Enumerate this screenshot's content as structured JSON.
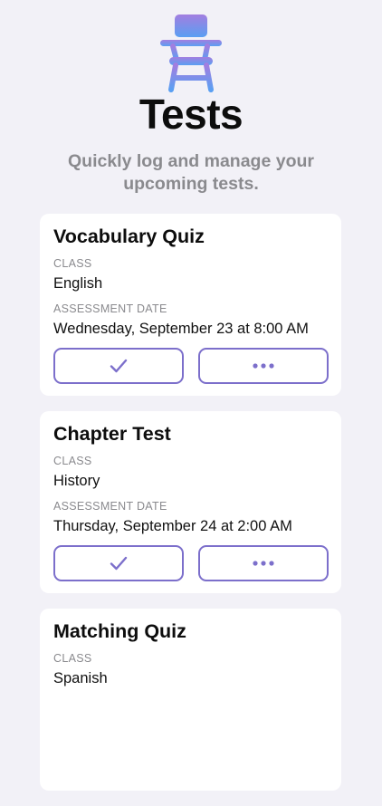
{
  "header": {
    "icon": "school-desk-icon",
    "title": "Tests",
    "subtitle": "Quickly log and manage your upcoming tests."
  },
  "colors": {
    "background": "#f2f1f7",
    "card": "#ffffff",
    "accent": "#7c6fcb",
    "icon_gradient_top": "#a27ee0",
    "icon_gradient_bottom": "#5a9ff2",
    "secondary_text": "#8a8a8e"
  },
  "tests": [
    {
      "title": "Vocabulary Quiz",
      "class_label": "CLASS",
      "class_value": "English",
      "date_label": "ASSESSMENT DATE",
      "date_value": "Wednesday, September 23 at 8:00 AM",
      "complete_icon": "checkmark-icon",
      "more_icon": "ellipsis-icon"
    },
    {
      "title": "Chapter Test",
      "class_label": "CLASS",
      "class_value": "History",
      "date_label": "ASSESSMENT DATE",
      "date_value": "Thursday, September 24 at 2:00 AM",
      "complete_icon": "checkmark-icon",
      "more_icon": "ellipsis-icon"
    },
    {
      "title": "Matching Quiz",
      "class_label": "CLASS",
      "class_value": "Spanish"
    }
  ]
}
